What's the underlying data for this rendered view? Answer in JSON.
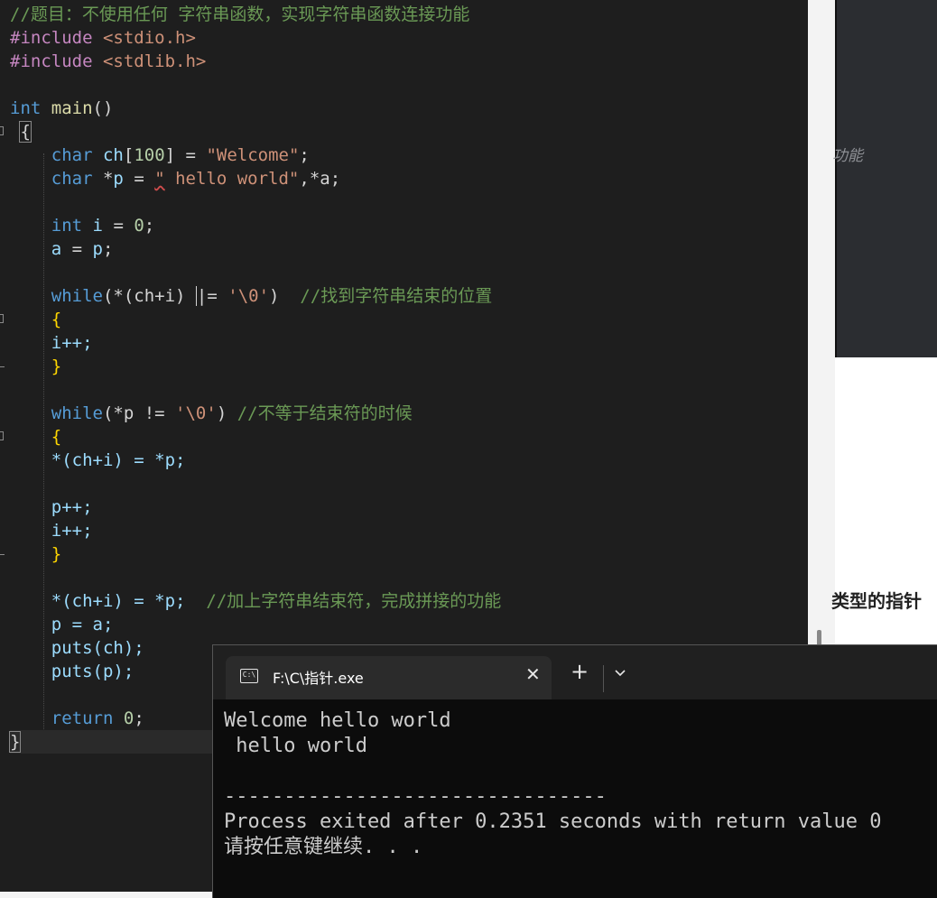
{
  "editor": {
    "lines": {
      "l1": {
        "comment": "//题目：不使用任何 字符串函数，实现字符串函数连接功能"
      },
      "l2": {
        "directive": "#include",
        "header": "<stdio.h>"
      },
      "l3": {
        "directive": "#include",
        "header": "<stdlib.h>"
      },
      "l5": {
        "type": "int",
        "func": "main",
        "parens": "()"
      },
      "l6": {
        "brace": "{"
      },
      "l7": {
        "type": "char",
        "name": "ch",
        "size": "100",
        "eq": " = ",
        "value": "\"Welcome\"",
        "end": ";"
      },
      "l8": {
        "type": "char",
        "star": " *",
        "name": "p",
        "eq": " = ",
        "quote": "\"",
        "value": " hello world\"",
        "rest": ",*a;"
      },
      "l10": {
        "type": "int",
        "name": "i",
        "eq": " = ",
        "value": "0",
        "end": ";"
      },
      "l11": {
        "lhs": "a",
        "eq": " = ",
        "rhs": "p",
        "end": ";"
      },
      "l13": {
        "kw": "while",
        "expr_a": "(*(ch+i) ",
        "op_a": "|",
        "expr_b": "= ",
        "value": "'\\0'",
        "close": ")",
        "comment": "//找到字符串结束的位置"
      },
      "l14": {
        "brace": "{"
      },
      "l15": {
        "stmt": "i++;"
      },
      "l16": {
        "brace": "}"
      },
      "l18": {
        "kw": "while",
        "expr": "(*p != ",
        "value": "'\\0'",
        "close": ")",
        "comment": "//不等于结束符的时候"
      },
      "l19": {
        "brace": "{"
      },
      "l20": {
        "stmt": "*(ch+i) = *p;"
      },
      "l22": {
        "stmt": "p++;"
      },
      "l23": {
        "stmt": "i++;"
      },
      "l24": {
        "brace": "}"
      },
      "l26": {
        "stmt": "*(ch+i) = *p;",
        "comment": "//加上字符串结束符，完成拼接的功能"
      },
      "l27": {
        "stmt": "p = a;"
      },
      "l28": {
        "stmt": "puts(ch);"
      },
      "l29": {
        "stmt": "puts(p);"
      },
      "l31": {
        "kw": "return",
        "value": "0",
        "end": ";"
      },
      "l32": {
        "brace": "}"
      }
    }
  },
  "background_window": {
    "partial_italic": "功能",
    "partial_heading": "类型的指针"
  },
  "terminal": {
    "tab_title": "F:\\C\\指针.exe",
    "tab_icon_text": "C:\\",
    "close_glyph": "✕",
    "new_tab_glyph": "+",
    "output": [
      "Welcome hello world",
      " hello world",
      "",
      "--------------------------------",
      "Process exited after 0.2351 seconds with return value 0",
      "请按任意键继续. . ."
    ]
  }
}
